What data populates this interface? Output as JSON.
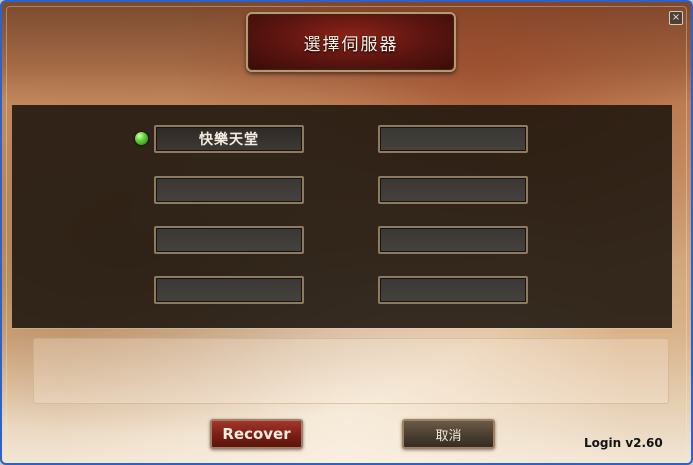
{
  "window": {
    "title": "選擇伺服器",
    "close_icon": "close-icon"
  },
  "servers": [
    {
      "label": "快樂天堂",
      "status": "online"
    },
    {
      "label": ""
    },
    {
      "label": ""
    },
    {
      "label": ""
    },
    {
      "label": ""
    },
    {
      "label": ""
    },
    {
      "label": ""
    },
    {
      "label": ""
    }
  ],
  "notice": {
    "text": ""
  },
  "buttons": {
    "recover": "Recover",
    "cancel": "取消"
  },
  "version": "Login v2.60",
  "colors": {
    "status_online": "#62d23a",
    "title_plate": "#5a1410",
    "recover_button": "#7a1e14",
    "window_border": "#2a63c9"
  }
}
